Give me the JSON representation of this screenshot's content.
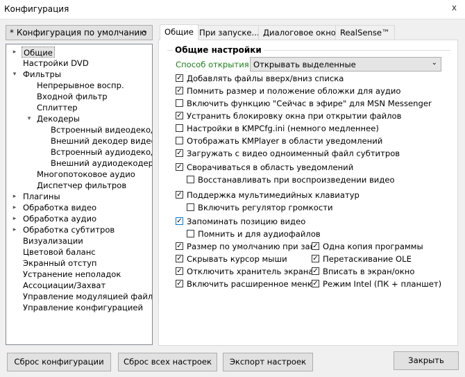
{
  "window": {
    "title": "Конфигурация",
    "close_label": "x"
  },
  "config_select": {
    "value": "* Конфигурация по умолчанию"
  },
  "tree": [
    {
      "label": "Общие"
    },
    {
      "label": "Настройки DVD"
    },
    {
      "label": "Фильтры"
    },
    {
      "label": "Непрерывное воспр."
    },
    {
      "label": "Входной фильтр"
    },
    {
      "label": "Сплиттер"
    },
    {
      "label": "Декодеры"
    },
    {
      "label": "Встроенный видеодекодер"
    },
    {
      "label": "Внешний декодер видео"
    },
    {
      "label": "Встроенный аудиодекодер"
    },
    {
      "label": "Внешний аудиодекодер"
    },
    {
      "label": "Многопотоковое аудио"
    },
    {
      "label": "Диспетчер фильтров"
    },
    {
      "label": "Плагины"
    },
    {
      "label": "Обработка видео"
    },
    {
      "label": "Обработка аудио"
    },
    {
      "label": "Обработка субтитров"
    },
    {
      "label": "Визуализации"
    },
    {
      "label": "Цветовой баланс"
    },
    {
      "label": "Экранный отступ"
    },
    {
      "label": "Устранение неполадок"
    },
    {
      "label": "Ассоциации/Захват"
    },
    {
      "label": "Управление модуляцией файла"
    },
    {
      "label": "Управление конфигурацией"
    }
  ],
  "tabs": [
    "Общие",
    "При запуске...",
    "Диалоговое окно",
    "RealSense™"
  ],
  "general": {
    "group_title": "Общие настройки",
    "open_method_label": "Способ открытия:",
    "open_method_value": "Открывать выделенные",
    "checkboxes": [
      {
        "label": "Добавлять файлы вверх/вниз списка",
        "checked": true
      },
      {
        "label": "Помнить размер и положение обложки для аудио",
        "checked": true
      },
      {
        "label": "Включить функцию \"Сейчас в эфире\" для MSN Messenger",
        "checked": false
      },
      {
        "label": "Устранить блокировку окна при открытии файлов",
        "checked": true
      },
      {
        "label": "Настройки в KMPCfg.ini (немного медленнее)",
        "checked": false
      },
      {
        "label": "Отображать KMPlayer в области уведомлений",
        "checked": false
      },
      {
        "label": "Загружать с видео одноименный файл субтитров",
        "checked": true
      },
      {
        "label": "Сворачиваться в область уведомлений",
        "checked": true
      },
      {
        "label": "Восстанавливать при воспроизведении видео",
        "checked": false
      },
      {
        "label": "Поддержка мультимедийных клавиатур",
        "checked": true
      },
      {
        "label": "Включить регулятор громкости",
        "checked": false
      },
      {
        "label": "Запоминать позицию видео",
        "checked": true
      },
      {
        "label": "Помнить и для аудиофайлов",
        "checked": false
      }
    ],
    "left_column": [
      {
        "label": "Размер по умолчанию при закр",
        "checked": true
      },
      {
        "label": "Скрывать курсор мыши",
        "checked": true
      },
      {
        "label": "Отключить хранитель экрана",
        "checked": true
      },
      {
        "label": "Включить расширенное меню",
        "checked": true
      }
    ],
    "right_column": [
      {
        "label": "Одна копия программы",
        "checked": true
      },
      {
        "label": "Перетаскивание OLE",
        "checked": true
      },
      {
        "label": "Вписать в экран/окно",
        "checked": true
      },
      {
        "label": "Режим Intel (ПК + планшет)",
        "checked": true
      }
    ]
  },
  "buttons": {
    "reset_config": "Сброс конфигурации",
    "reset_all": "Сброс всех настроек",
    "export": "Экспорт настроек",
    "close": "Закрыть"
  }
}
